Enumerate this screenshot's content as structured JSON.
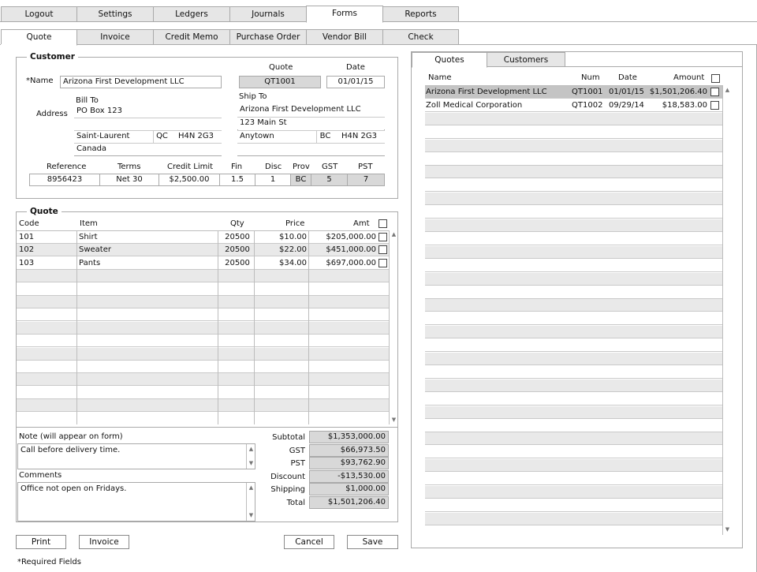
{
  "main_tabs": [
    {
      "label": "Logout"
    },
    {
      "label": "Settings"
    },
    {
      "label": "Ledgers"
    },
    {
      "label": "Journals"
    },
    {
      "label": "Forms"
    },
    {
      "label": "Reports"
    }
  ],
  "sub_tabs": [
    {
      "label": "Quote"
    },
    {
      "label": "Invoice"
    },
    {
      "label": "Credit Memo"
    },
    {
      "label": "Purchase Order"
    },
    {
      "label": "Vendor Bill"
    },
    {
      "label": "Check"
    }
  ],
  "customer": {
    "section_title": "Customer",
    "name_label": "*Name",
    "name_value": "Arizona First Development LLC",
    "quote_label": "Quote",
    "quote_value": "QT1001",
    "date_label": "Date",
    "date_value": "01/01/15",
    "address_label": "Address",
    "bill_to_label": "Bill To",
    "bill_to": {
      "line1": "PO Box 123",
      "line2": "",
      "city": "Saint-Laurent",
      "prov": "QC",
      "postal": "H4N 2G3",
      "country": "Canada"
    },
    "ship_to_label": "Ship To",
    "ship_to": {
      "line1": "Arizona First Development LLC",
      "line2": "123 Main St",
      "city": "Anytown",
      "prov": "BC",
      "postal": "H4N 2G3",
      "country": ""
    },
    "terms_headers": {
      "reference": "Reference",
      "terms": "Terms",
      "credit_limit": "Credit Limit",
      "fin": "Fin",
      "disc": "Disc",
      "prov": "Prov",
      "gst": "GST",
      "pst": "PST"
    },
    "terms_values": {
      "reference": "8956423",
      "terms": "Net 30",
      "credit_limit": "$2,500.00",
      "fin": "1.5",
      "disc": "1",
      "prov": "BC",
      "gst": "5",
      "pst": "7"
    }
  },
  "quote": {
    "section_title": "Quote",
    "headers": {
      "code": "Code",
      "item": "Item",
      "qty": "Qty",
      "price": "Price",
      "amt": "Amt"
    },
    "rows": [
      {
        "code": "101",
        "item": "Shirt",
        "qty": "20500",
        "price": "$10.00",
        "amt": "$205,000.00"
      },
      {
        "code": "102",
        "item": "Sweater",
        "qty": "20500",
        "price": "$22.00",
        "amt": "$451,000.00"
      },
      {
        "code": "103",
        "item": "Pants",
        "qty": "20500",
        "price": "$34.00",
        "amt": "$697,000.00"
      }
    ],
    "note_label": "Note (will appear on form)",
    "note_value": "Call before delivery time.",
    "comments_label": "Comments",
    "comments_value": "Office not open on Fridays.",
    "totals": [
      {
        "label": "Subtotal",
        "value": "$1,353,000.00"
      },
      {
        "label": "GST",
        "value": "$66,973.50"
      },
      {
        "label": "PST",
        "value": "$93,762.90"
      },
      {
        "label": "Discount",
        "value": "-$13,530.00"
      },
      {
        "label": "Shipping",
        "value": "$1,000.00"
      },
      {
        "label": "Total",
        "value": "$1,501,206.40"
      }
    ]
  },
  "buttons": {
    "print": "Print",
    "invoice": "Invoice",
    "cancel": "Cancel",
    "save": "Save"
  },
  "required_note": "*Required Fields",
  "right_panel": {
    "tabs": [
      {
        "label": "Quotes"
      },
      {
        "label": "Customers"
      }
    ],
    "headers": {
      "name": "Name",
      "num": "Num",
      "date": "Date",
      "amount": "Amount"
    },
    "rows": [
      {
        "name": "Arizona First Development LLC",
        "num": "QT1001",
        "date": "01/01/15",
        "amount": "$1,501,206.40"
      },
      {
        "name": "Zoll Medical Corporation",
        "num": "QT1002",
        "date": "09/29/14",
        "amount": "$18,583.00"
      }
    ]
  }
}
